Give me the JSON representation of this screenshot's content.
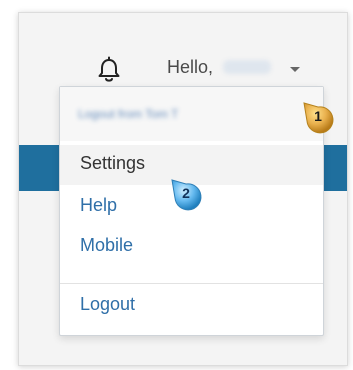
{
  "header": {
    "greeting": "Hello,",
    "user_name": "Evan"
  },
  "dropdown": {
    "header_text": "Logout from Tom T",
    "items": [
      {
        "label": "Settings"
      },
      {
        "label": "Help"
      },
      {
        "label": "Mobile"
      }
    ],
    "logout": "Logout"
  },
  "callouts": [
    {
      "number": "1",
      "color": "#e0a63a"
    },
    {
      "number": "2",
      "color": "#49a8e8"
    }
  ],
  "colors": {
    "accent_blue": "#1f6f9e",
    "link": "#2f6fa8"
  },
  "icons": {
    "notifications": "bell-icon",
    "menu_toggle": "chevron-down-icon"
  }
}
